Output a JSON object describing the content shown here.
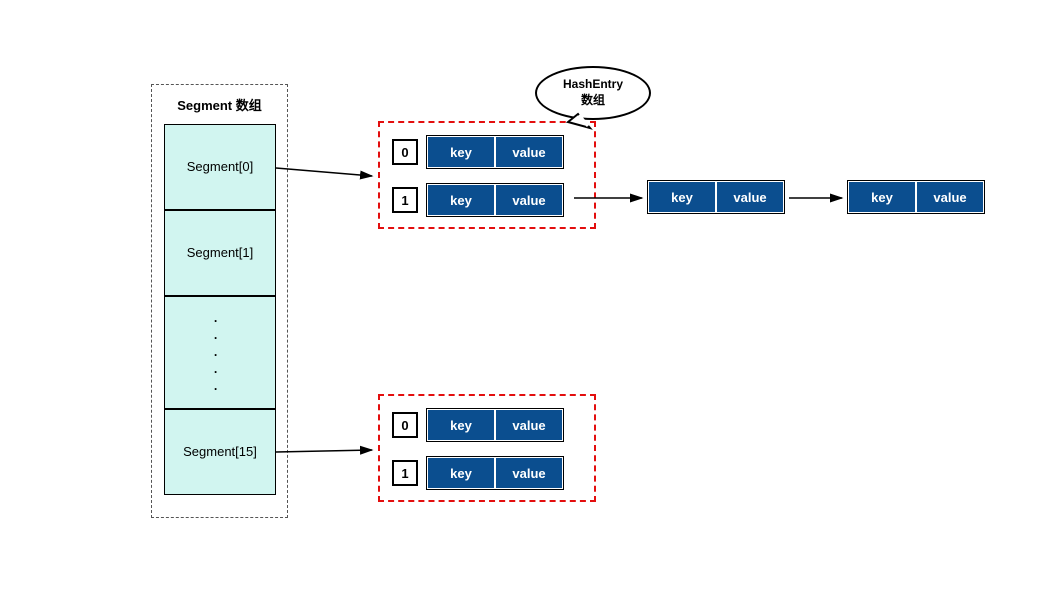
{
  "segmentArray": {
    "title": "Segment 数组",
    "cells": [
      "Segment[0]",
      "Segment[1]",
      "．\n．\n．\n．\n．",
      "Segment[15]"
    ]
  },
  "bubble": "HashEntry\n数组",
  "hashEntry": {
    "key_label": "key",
    "value_label": "value",
    "idx0": "0",
    "idx1": "1"
  }
}
